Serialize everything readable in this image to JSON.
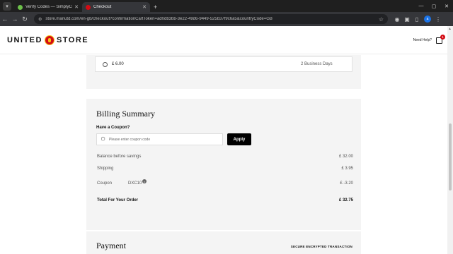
{
  "browser": {
    "tabs": [
      {
        "title": "Verify Codes — SimplyCodes",
        "favicon_color": "#6cc04a",
        "active": false
      },
      {
        "title": "Checkout",
        "favicon_color": "#d50b13",
        "active": true
      }
    ],
    "url": "store.manutd.com/en-gb/checkout?confirmationCartToken=ad0db3bb-3e22-49d6-9449-525b37f9c6a5&countryCode=GB",
    "avatar_letter": "a"
  },
  "header": {
    "logo_left": "UNITED",
    "logo_right": "STORE",
    "need_help": "Need Help?",
    "bag_count": "1"
  },
  "delivery": {
    "option_price": "£ 6.00",
    "option_days": "2 Business Days"
  },
  "billing": {
    "title": "Billing Summary",
    "coupon_question": "Have a Coupon?",
    "coupon_placeholder": "Please enter coupon code",
    "apply_label": "Apply",
    "rows": {
      "balance_label": "Balance before savings",
      "balance_value": "£ 32.00",
      "shipping_label": "Shipping",
      "shipping_value": "£ 3.95",
      "coupon_label": "Coupon",
      "coupon_code": "DXC10",
      "coupon_value": "£ -3.20",
      "total_label": "Total For Your Order",
      "total_value": "£ 32.75"
    }
  },
  "payment": {
    "title": "Payment",
    "secure_label": "SECURE ENCRYPTED TRANSACTION"
  },
  "colors": {
    "brand_red": "#d50b13",
    "apply_button": "#000000",
    "card_bg": "#f4f4f4"
  }
}
